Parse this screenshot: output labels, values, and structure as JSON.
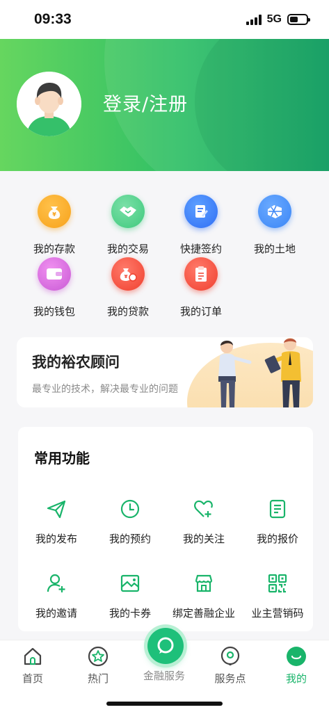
{
  "status_bar": {
    "time": "09:33",
    "network": "5G"
  },
  "header": {
    "login_label": "登录/注册"
  },
  "services": [
    {
      "label": "我的存款",
      "icon": "deposit-bag-icon",
      "color": "#f7a21b"
    },
    {
      "label": "我的交易",
      "icon": "handshake-icon",
      "color": "#3ec97c"
    },
    {
      "label": "快捷签约",
      "icon": "sign-contract-icon",
      "color": "#2f7bf5"
    },
    {
      "label": "我的土地",
      "icon": "land-icon",
      "color": "#3b86f6"
    },
    {
      "label": "我的钱包",
      "icon": "wallet-icon",
      "color": "#d85fd8"
    },
    {
      "label": "我的贷款",
      "icon": "loan-bag-icon",
      "color": "#f04a3a"
    },
    {
      "label": "我的订单",
      "icon": "order-clipboard-icon",
      "color": "#f04a3a"
    }
  ],
  "advisor": {
    "title": "我的裕农顾问",
    "subtitle": "最专业的技术，解决最专业的问题"
  },
  "common": {
    "title": "常用功能",
    "items": [
      {
        "label": "我的发布",
        "icon": "paper-plane-icon"
      },
      {
        "label": "我的预约",
        "icon": "clock-icon"
      },
      {
        "label": "我的关注",
        "icon": "heart-plus-icon"
      },
      {
        "label": "我的报价",
        "icon": "document-list-icon"
      },
      {
        "label": "我的邀请",
        "icon": "add-user-icon"
      },
      {
        "label": "我的卡券",
        "icon": "coupon-image-icon"
      },
      {
        "label": "绑定善融企业",
        "icon": "store-icon"
      },
      {
        "label": "业主营销码",
        "icon": "qr-code-icon"
      }
    ]
  },
  "tabbar": {
    "items": [
      {
        "label": "首页",
        "icon": "home-icon"
      },
      {
        "label": "热门",
        "icon": "star-circle-icon"
      },
      {
        "label": "金融服务",
        "icon": "chat-bubble-icon"
      },
      {
        "label": "服务点",
        "icon": "location-icon"
      },
      {
        "label": "我的",
        "icon": "profile-icon"
      }
    ],
    "active": "我的",
    "accent": "#19b46a"
  }
}
